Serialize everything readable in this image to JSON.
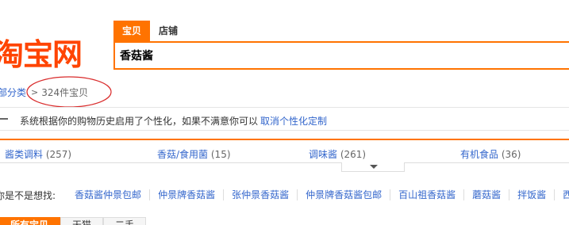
{
  "brand": {
    "logo_text": "淘宝网",
    "accent": "#ff7300"
  },
  "search": {
    "tabs": [
      {
        "label": "宝贝",
        "active": true
      },
      {
        "label": "店铺",
        "active": false
      }
    ],
    "query": "香菇酱"
  },
  "breadcrumb": {
    "all_label": "部分类",
    "separator": ">",
    "count_label": "324件宝贝"
  },
  "notice": {
    "text": "系统根据你的购物历史启用了个性化，如果不满意你可以",
    "link": "取消个性化定制"
  },
  "categories": [
    {
      "name": "酱类调料",
      "count": "(257)"
    },
    {
      "name": "香菇/食用菌",
      "count": "(15)"
    },
    {
      "name": "调味酱",
      "count": "(261)"
    },
    {
      "name": "有机食品",
      "count": "(36)"
    }
  ],
  "suggestions": {
    "label": "你是不是想找:",
    "items": [
      "香菇酱仲景包邮",
      "仲景牌香菇酱",
      "张仲景香菇酱",
      "仲景牌香菇酱包邮",
      "百山祖香菇酱",
      "蘑菇酱",
      "拌饭酱",
      "西"
    ]
  },
  "sort": {
    "tabs": [
      "所有宝贝",
      "天猫",
      "二手"
    ]
  }
}
